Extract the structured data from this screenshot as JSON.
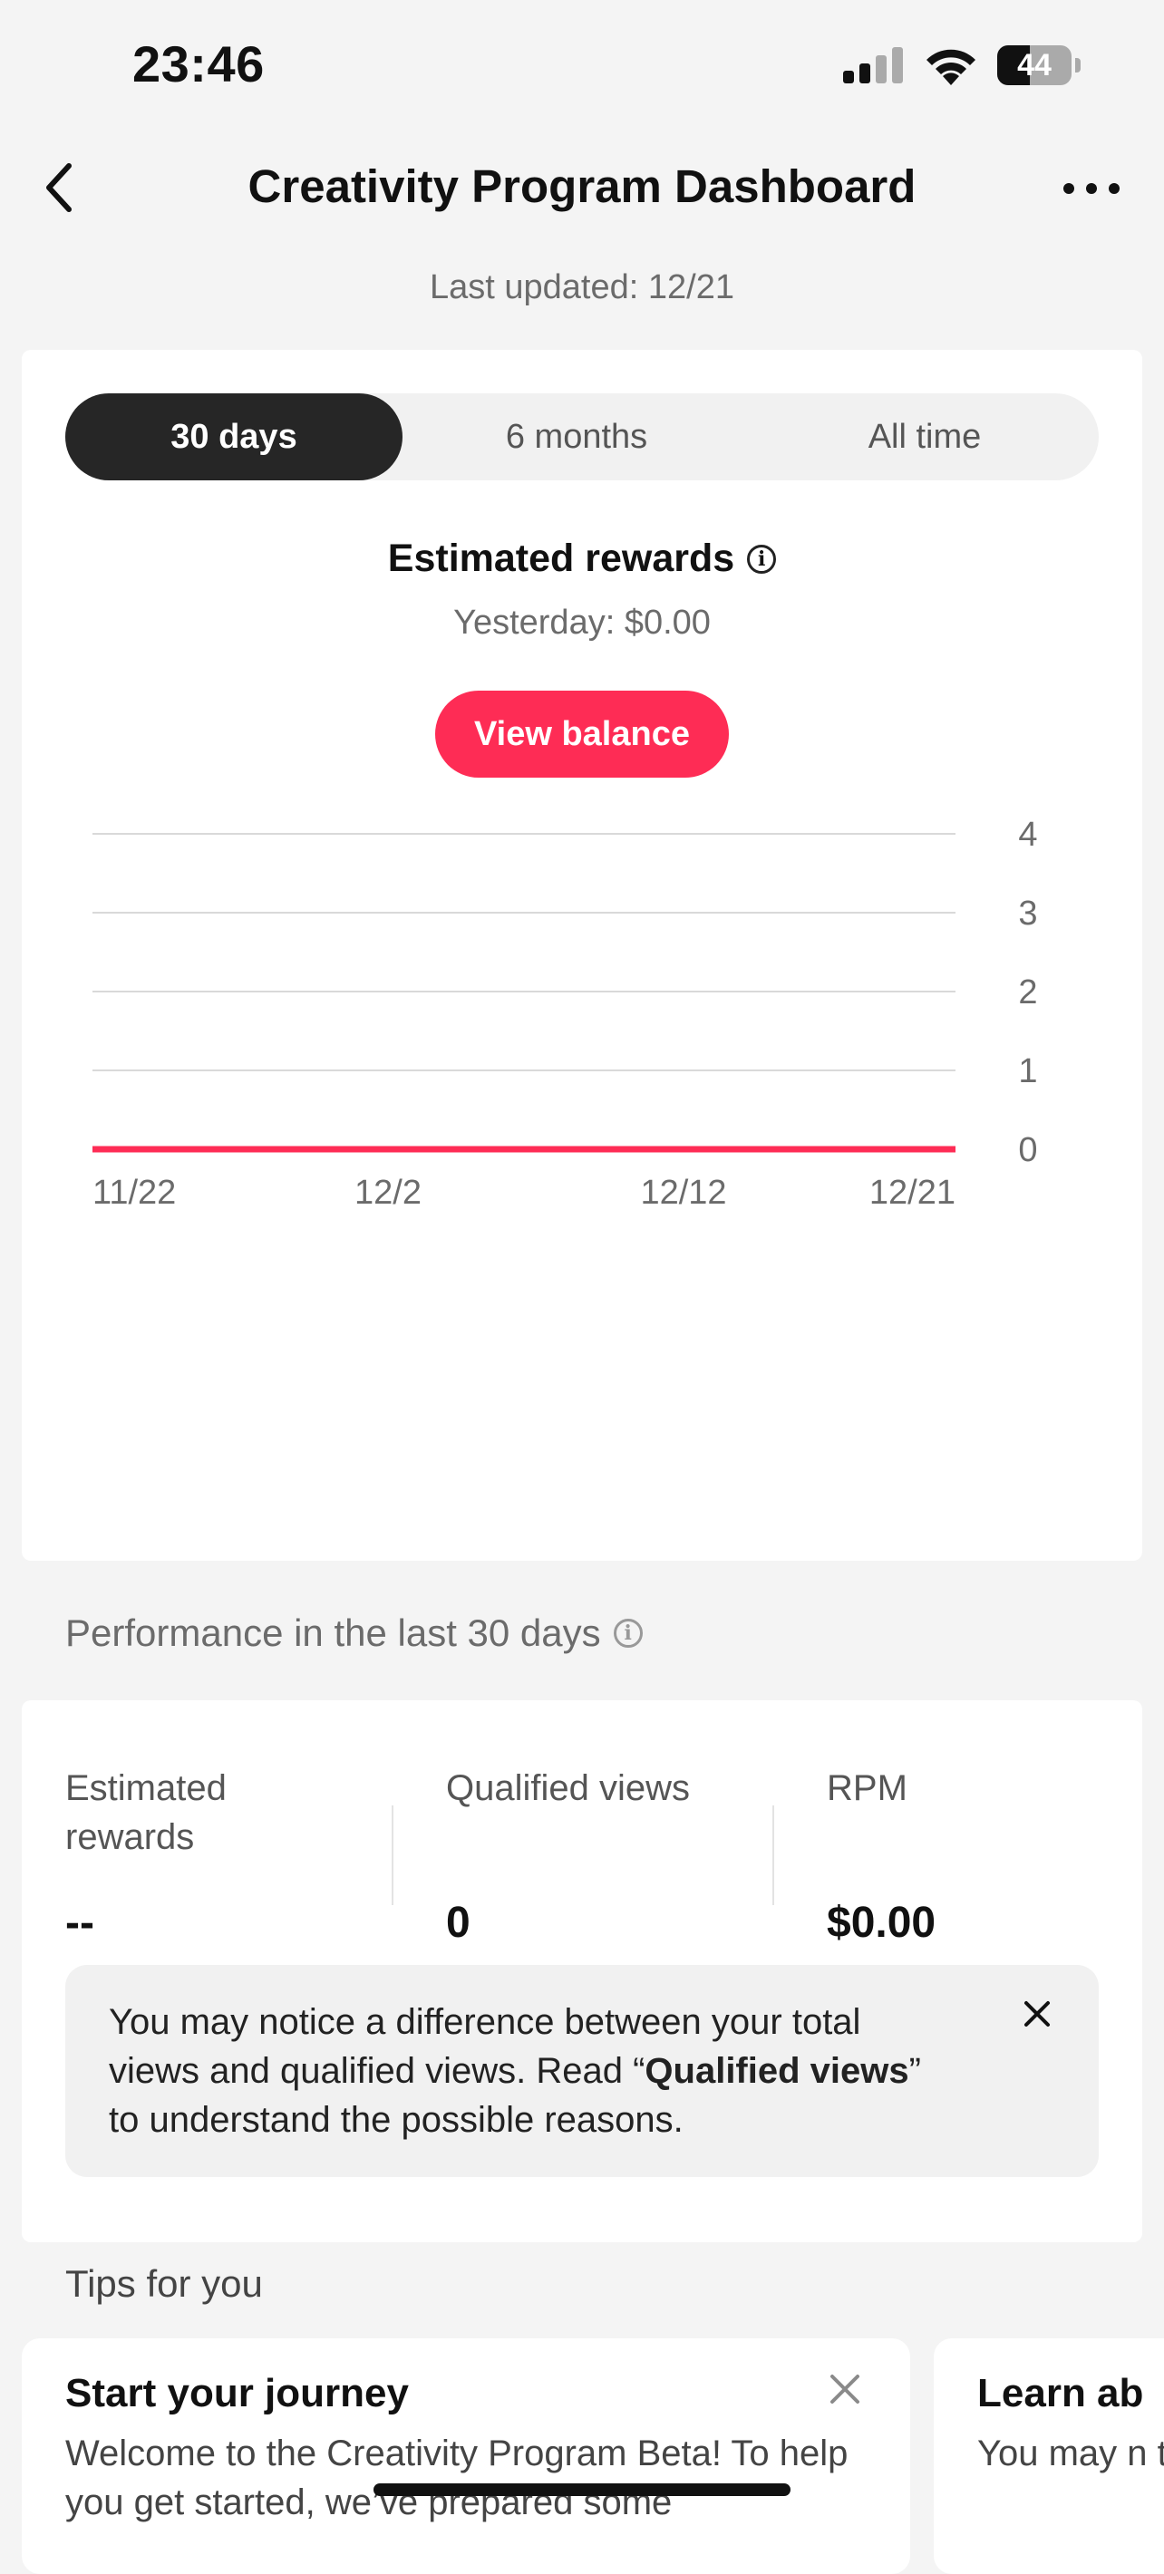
{
  "status_bar": {
    "time": "23:46",
    "battery": "44",
    "battery_level": 0.44
  },
  "nav": {
    "title": "Creativity Program Dashboard"
  },
  "last_updated": "Last updated: 12/21",
  "tabs": [
    "30 days",
    "6 months",
    "All time"
  ],
  "selected_tab": "30 days",
  "rewards": {
    "title": "Estimated rewards",
    "yesterday": "Yesterday: $0.00",
    "view_balance_label": "View balance"
  },
  "chart_data": {
    "type": "line",
    "x": [
      "11/22",
      "12/2",
      "12/12",
      "12/21"
    ],
    "x_tick_labels": [
      "11/22",
      "12/2",
      "12/12",
      "12/21"
    ],
    "series": [
      {
        "values": [
          0,
          0,
          0,
          0
        ]
      }
    ],
    "y_tick_labels": [
      "4",
      "3",
      "2",
      "1",
      "0"
    ],
    "ylim": [
      0,
      4
    ],
    "grid": true,
    "line_color": "#fe2c55"
  },
  "performance": {
    "heading": "Performance in the last 30 days",
    "metrics": [
      {
        "label": "Estimated rewards",
        "value": "--"
      },
      {
        "label": "Qualified views",
        "value": "0"
      },
      {
        "label": "RPM",
        "value": "$0.00"
      }
    ],
    "notice": {
      "before": "You may notice a difference between your total views and qualified views. Read “",
      "bold": "Qualified views",
      "after": "” to understand the possible reasons."
    }
  },
  "tips": {
    "heading": "Tips for you",
    "cards": [
      {
        "title": "Start your journey",
        "text": "Welcome to the Creativity Program Beta! To help you get started, we’ve prepared some"
      },
      {
        "title": "Learn ab",
        "text": "You may n total view"
      }
    ]
  },
  "colors": {
    "accent": "#fe2c55",
    "segment_active": "#262626",
    "background": "#f4f4f4"
  }
}
